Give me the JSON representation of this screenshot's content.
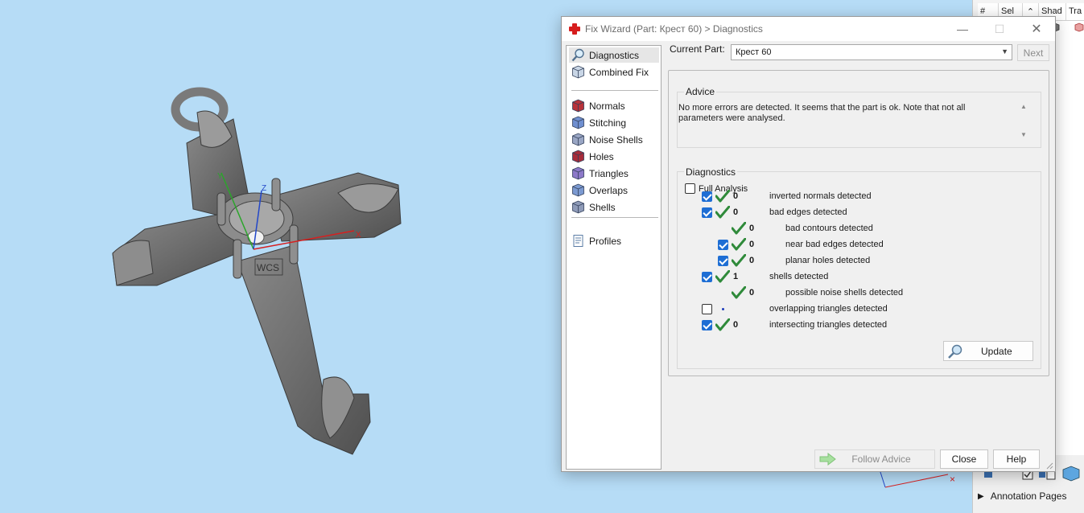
{
  "dialog": {
    "title": "Fix Wizard (Part: Крест 60) > Diagnostics",
    "nav": [
      {
        "label": "Diagnostics",
        "icon": "magnifier-icon"
      },
      {
        "label": "Combined Fix",
        "icon": "combined-fix-icon"
      },
      {
        "label": "Normals",
        "icon": "normals-cube-icon"
      },
      {
        "label": "Stitching",
        "icon": "stitching-icon"
      },
      {
        "label": "Noise Shells",
        "icon": "noise-shells-icon"
      },
      {
        "label": "Holes",
        "icon": "holes-icon"
      },
      {
        "label": "Triangles",
        "icon": "triangles-icon"
      },
      {
        "label": "Overlaps",
        "icon": "overlaps-icon"
      },
      {
        "label": "Shells",
        "icon": "shells-icon"
      },
      {
        "label": "Profiles",
        "icon": "profiles-icon"
      }
    ],
    "current_part_label": "Current Part:",
    "current_part_value": "Крест 60",
    "next_label": "Next",
    "advice_title": "Advice",
    "advice_text": "No more errors are detected. It seems that the part is ok. Note that not all parameters were analysed.",
    "diagnostics_title": "Diagnostics",
    "full_analysis_label": "Full Analysis",
    "full_analysis_checked": false,
    "diagnostics": [
      {
        "checkbox": true,
        "checked": true,
        "ok": true,
        "count": "0",
        "label": "inverted normals detected",
        "indent": 0
      },
      {
        "checkbox": true,
        "checked": true,
        "ok": true,
        "count": "0",
        "label": "bad edges detected",
        "indent": 0
      },
      {
        "checkbox": false,
        "checked": false,
        "ok": true,
        "count": "0",
        "label": "bad contours detected",
        "indent": 1
      },
      {
        "checkbox": true,
        "checked": true,
        "ok": true,
        "count": "0",
        "label": "near bad edges detected",
        "indent": 1
      },
      {
        "checkbox": true,
        "checked": true,
        "ok": true,
        "count": "0",
        "label": "planar holes detected",
        "indent": 1
      },
      {
        "checkbox": true,
        "checked": true,
        "ok": true,
        "count": "1",
        "label": "shells detected",
        "indent": 0
      },
      {
        "checkbox": false,
        "checked": false,
        "ok": true,
        "count": "0",
        "label": "possible noise shells detected",
        "indent": 1
      },
      {
        "checkbox": true,
        "checked": false,
        "ok": false,
        "count": "",
        "label": "overlapping triangles detected",
        "indent": 0
      },
      {
        "checkbox": true,
        "checked": true,
        "ok": true,
        "count": "0",
        "label": "intersecting triangles detected",
        "indent": 0
      }
    ],
    "update_label": "Update",
    "follow_advice_label": "Follow Advice",
    "close_label": "Close",
    "help_label": "Help"
  },
  "viewport": {
    "wcs_label": "WCS",
    "axis_x": "X",
    "axis_y": "Y",
    "axis_z": "Z",
    "background": "#b6dcf6"
  },
  "side_panel": {
    "columns": [
      "#",
      "Sel",
      "Shad",
      "Tra"
    ],
    "annotation_label": "Annotation Pages"
  },
  "colors": {
    "check_green": "#2f8a3a",
    "checkbox_blue": "#1e6ed4",
    "brand_red": "#d61d1d"
  }
}
